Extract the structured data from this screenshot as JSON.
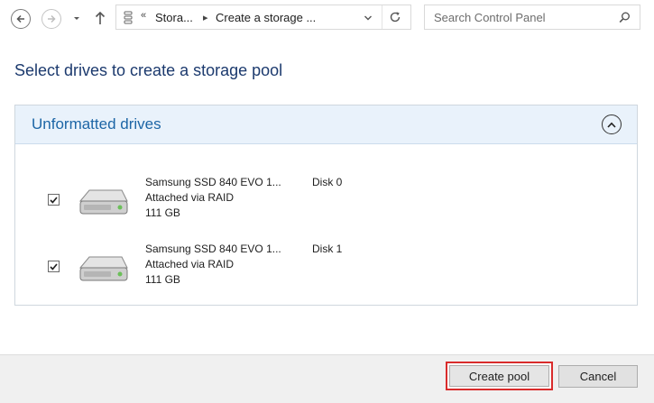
{
  "address_bar": {
    "back_icon": "back-arrow-icon",
    "forward_icon": "forward-arrow-icon",
    "recent_icon": "chevron-down-icon",
    "up_icon": "up-arrow-icon",
    "overflow": "«",
    "segments": [
      "Stora...",
      "Create a storage ..."
    ],
    "search_placeholder": "Search Control Panel"
  },
  "page": {
    "heading": "Select drives to create a storage pool"
  },
  "group": {
    "title": "Unformatted drives",
    "drives": [
      {
        "checked": true,
        "name": "Samsung SSD 840 EVO 1...",
        "connection": "Attached via RAID",
        "size": "111 GB",
        "disk": "Disk 0"
      },
      {
        "checked": true,
        "name": "Samsung SSD 840 EVO 1...",
        "connection": "Attached via RAID",
        "size": "111 GB",
        "disk": "Disk 1"
      }
    ]
  },
  "footer": {
    "create_label": "Create pool",
    "cancel_label": "Cancel",
    "highlight_color": "#d92b2b"
  }
}
